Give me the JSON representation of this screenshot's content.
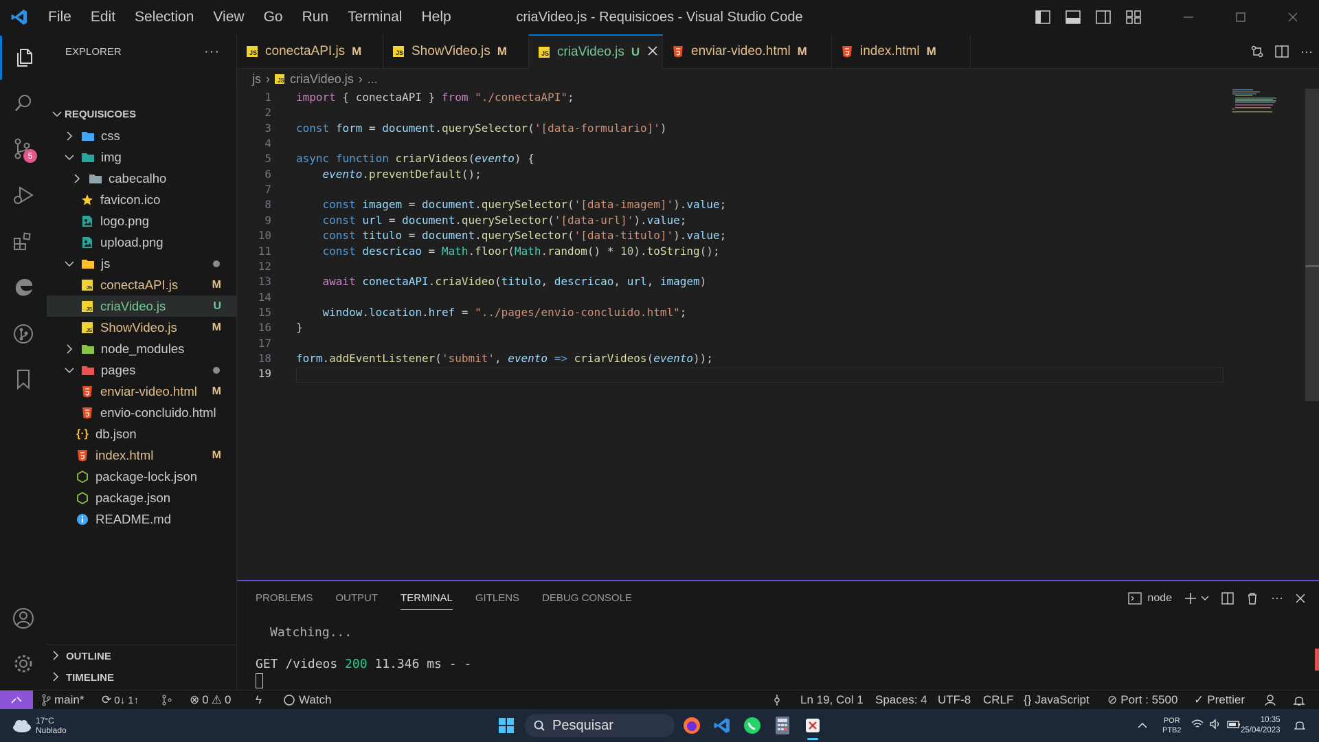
{
  "window": {
    "title": "criaVideo.js - Requisicoes - Visual Studio Code",
    "menu": [
      "File",
      "Edit",
      "Selection",
      "View",
      "Go",
      "Run",
      "Terminal",
      "Help"
    ]
  },
  "sidebar": {
    "header": "EXPLORER",
    "root": "REQUISICOES",
    "tree": [
      {
        "label": "css",
        "kind": "folder",
        "state": "collapsed",
        "icon": "css-folder-icon"
      },
      {
        "label": "img",
        "kind": "folder",
        "state": "expanded",
        "icon": "image-folder-icon"
      },
      {
        "label": "cabecalho",
        "kind": "folder",
        "state": "collapsed",
        "icon": "folder-icon"
      },
      {
        "label": "favicon.ico",
        "kind": "file",
        "icon": "star-icon"
      },
      {
        "label": "logo.png",
        "kind": "file",
        "icon": "image-file-icon"
      },
      {
        "label": "upload.png",
        "kind": "file",
        "icon": "image-file-icon"
      },
      {
        "label": "js",
        "kind": "folder",
        "state": "expanded",
        "icon": "js-folder-icon",
        "dot": true
      },
      {
        "label": "conectaAPI.js",
        "kind": "file",
        "icon": "js-file-icon",
        "badge": "M"
      },
      {
        "label": "criaVideo.js",
        "kind": "file",
        "icon": "js-file-icon",
        "badge": "U",
        "selected": true
      },
      {
        "label": "ShowVideo.js",
        "kind": "file",
        "icon": "js-file-icon",
        "badge": "M"
      },
      {
        "label": "node_modules",
        "kind": "folder",
        "state": "collapsed",
        "icon": "node-folder-icon"
      },
      {
        "label": "pages",
        "kind": "folder",
        "state": "expanded",
        "icon": "pages-folder-icon",
        "dot": true
      },
      {
        "label": "enviar-video.html",
        "kind": "file",
        "icon": "html-file-icon",
        "badge": "M"
      },
      {
        "label": "envio-concluido.html",
        "kind": "file",
        "icon": "html-file-icon"
      },
      {
        "label": "db.json",
        "kind": "file",
        "icon": "json-file-icon"
      },
      {
        "label": "index.html",
        "kind": "file",
        "icon": "html-file-icon",
        "badge": "M"
      },
      {
        "label": "package-lock.json",
        "kind": "file",
        "icon": "node-file-icon"
      },
      {
        "label": "package.json",
        "kind": "file",
        "icon": "node-file-icon"
      },
      {
        "label": "README.md",
        "kind": "file",
        "icon": "info-icon"
      }
    ],
    "outline": "OUTLINE",
    "timeline": "TIMELINE",
    "scm_badge": "5"
  },
  "tabs": [
    {
      "label": "conectaAPI.js",
      "badge": "M",
      "type": "js"
    },
    {
      "label": "ShowVideo.js",
      "badge": "M",
      "type": "js"
    },
    {
      "label": "criaVideo.js",
      "badge": "U",
      "type": "js",
      "active": true
    },
    {
      "label": "enviar-video.html",
      "badge": "M",
      "type": "html"
    },
    {
      "label": "index.html",
      "badge": "M",
      "type": "html"
    }
  ],
  "breadcrumb": {
    "folder": "js",
    "file": "criaVideo.js",
    "more": "..."
  },
  "editor": {
    "line_numbers": [
      "1",
      "2",
      "3",
      "4",
      "5",
      "6",
      "7",
      "8",
      "9",
      "10",
      "11",
      "12",
      "13",
      "14",
      "15",
      "16",
      "17",
      "18",
      "19"
    ],
    "current_line": "19",
    "code": {
      "l1": [
        "import",
        " { conectaAPI } ",
        "from",
        " ",
        "\"./conectaAPI\"",
        ";"
      ],
      "l3": [
        "const",
        " ",
        "form",
        " = ",
        "document",
        ".",
        "querySelector",
        "(",
        "'[data-formulario]'",
        ")"
      ],
      "l5": [
        "async",
        " ",
        "function",
        " ",
        "criarVideos",
        "(",
        "evento",
        ") {"
      ],
      "l6": [
        "    ",
        "evento",
        ".",
        "preventDefault",
        "();"
      ],
      "l8": [
        "    ",
        "const",
        " ",
        "imagem",
        " = ",
        "document",
        ".",
        "querySelector",
        "(",
        "'[data-imagem]'",
        ").",
        "value",
        ";"
      ],
      "l9": [
        "    ",
        "const",
        " ",
        "url",
        " = ",
        "document",
        ".",
        "querySelector",
        "(",
        "'[data-url]'",
        ").",
        "value",
        ";"
      ],
      "l10": [
        "    ",
        "const",
        " ",
        "titulo",
        " = ",
        "document",
        ".",
        "querySelector",
        "(",
        "'[data-titulo]'",
        ").",
        "value",
        ";"
      ],
      "l11": [
        "    ",
        "const",
        " ",
        "descricao",
        " = ",
        "Math",
        ".",
        "floor",
        "(",
        "Math",
        ".",
        "random",
        "() * ",
        "10",
        ").",
        "toString",
        "();"
      ],
      "l13": [
        "    ",
        "await",
        " ",
        "conectaAPI",
        ".",
        "criaVideo",
        "(",
        "titulo",
        ", ",
        "descricao",
        ", ",
        "url",
        ", ",
        "imagem",
        ")"
      ],
      "l15": [
        "    ",
        "window",
        ".",
        "location",
        ".",
        "href",
        " = ",
        "\"../pages/envio-concluido.html\"",
        ";"
      ],
      "l16": [
        "}"
      ],
      "l18": [
        "form",
        ".",
        "addEventListener",
        "(",
        "'submit'",
        ", ",
        "evento",
        " => ",
        "criarVideos",
        "(",
        "evento",
        "));"
      ]
    }
  },
  "panel": {
    "tabs": [
      "PROBLEMS",
      "OUTPUT",
      "TERMINAL",
      "GITLENS",
      "DEBUG CONSOLE"
    ],
    "active_tab": "TERMINAL",
    "shell": "node",
    "terminal": {
      "line1": "Watching...",
      "line2_prefix": "GET /videos ",
      "line2_status": "200",
      "line2_suffix": " 11.346 ms - -"
    }
  },
  "statusbar": {
    "branch": "main*",
    "sync": "0↓ 1↑",
    "errors": "0",
    "warnings": "0",
    "watch": "Watch",
    "position": "Ln 19, Col 1",
    "spaces": "Spaces: 4",
    "encoding": "UTF-8",
    "eol": "CRLF",
    "language": "JavaScript",
    "port": "Port : 5500",
    "prettier": "Prettier"
  },
  "taskbar": {
    "weather_temp": "17°C",
    "weather_desc": "Nublado",
    "search_placeholder": "Pesquisar",
    "lang1": "POR",
    "lang2": "PTB2",
    "time": "10:35",
    "date": "25/04/2023"
  },
  "colors": {
    "accent": "#0078d4",
    "modified": "#e2c08d",
    "untracked": "#73c991",
    "remote": "#8c54d9",
    "panel_border": "#6c4bd6"
  }
}
